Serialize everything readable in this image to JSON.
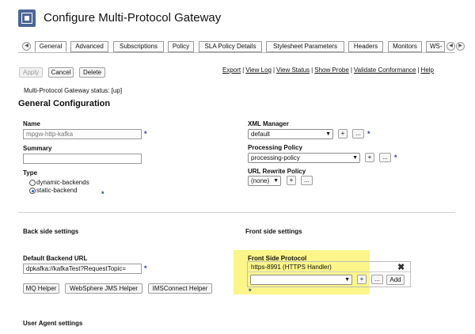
{
  "header": {
    "title": "Configure Multi-Protocol Gateway"
  },
  "tabs": {
    "prev_icon": "chevron-left-icon",
    "items": [
      {
        "label": "General"
      },
      {
        "label": "Advanced"
      },
      {
        "label": "Subscriptions"
      },
      {
        "label": "Policy"
      },
      {
        "label": "SLA Policy Details"
      },
      {
        "label": "Stylesheet Parameters"
      },
      {
        "label": "Headers"
      },
      {
        "label": "Monitors"
      },
      {
        "label": "WS-"
      }
    ],
    "active": "General",
    "prev_page_icon": "chevron-left-icon",
    "next_page_icon": "chevron-right-icon"
  },
  "toolbar": {
    "apply": "Apply",
    "cancel": "Cancel",
    "delete": "Delete",
    "links": [
      "Export",
      "View Log",
      "View Status",
      "Show Probe",
      "Validate Conformance",
      "Help"
    ],
    "link_separator": "|"
  },
  "status": {
    "text": "Multi-Protocol Gateway status: [up]"
  },
  "general": {
    "heading": "General Configuration",
    "name_label": "Name",
    "name_value": "mpgw-http-kafka",
    "summary_label": "Summary",
    "summary_value": "",
    "type_label": "Type",
    "type_options": [
      "dynamic-backends",
      "static-backend"
    ],
    "type_selected": "static-backend",
    "required_marker": "*",
    "xml_manager_label": "XML Manager",
    "xml_manager_value": "default",
    "processing_policy_label": "Processing Policy",
    "processing_policy_value": "processing-policy",
    "url_rewrite_label": "URL Rewrite Policy",
    "url_rewrite_value": "(none)",
    "add_symbol": "+",
    "more_symbol": "..."
  },
  "back_side": {
    "heading": "Back side settings",
    "backend_url_label": "Default Backend URL",
    "backend_url_value": "dpkafka://kafkaTest?RequestTopic=",
    "helpers": [
      "MQ Helper",
      "WebSphere JMS Helper",
      "IMSConnect Helper"
    ]
  },
  "front_side": {
    "heading": "Front side settings",
    "protocol_label": "Front Side Protocol",
    "protocols": [
      "https-8991 (HTTPS Handler)"
    ],
    "new_protocol_value": "",
    "add_label": "Add",
    "highlight_color": "#fbf58a"
  },
  "user_agent": {
    "heading": "User Agent settings"
  },
  "colors": {
    "brand": "#4c6696",
    "required_star": "#1a3fa6",
    "highlight": "#fbf58a"
  }
}
